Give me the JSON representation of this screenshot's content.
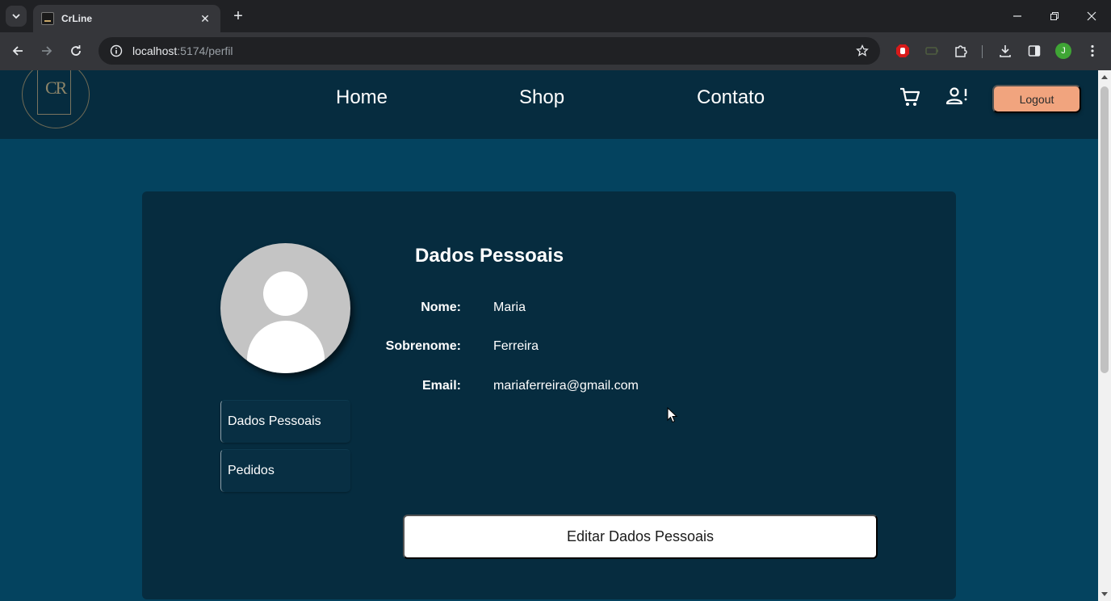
{
  "browser": {
    "tab_title": "CrLine",
    "close_glyph": "✕",
    "new_tab_glyph": "+",
    "url_host": "localhost",
    "url_path": ":5174/perfil",
    "profile_initial": "J"
  },
  "header": {
    "logo_text": "CR",
    "nav": {
      "home": "Home",
      "shop": "Shop",
      "contact": "Contato"
    },
    "logout_label": "Logout"
  },
  "profile": {
    "menu": {
      "personal": "Dados Pessoais",
      "orders": "Pedidos"
    },
    "section_title": "Dados Pessoais",
    "fields": {
      "name": {
        "label": "Nome:",
        "value": "Maria"
      },
      "surname": {
        "label": "Sobrenome:",
        "value": "Ferreira"
      },
      "email": {
        "label": "Email:",
        "value": "mariaferreira@gmail.com"
      }
    },
    "edit_label": "Editar Dados Pessoais"
  },
  "colors": {
    "page_bg": "#04435f",
    "header_bg": "#062c3f",
    "card_bg": "#062c3f",
    "logout_bg": "#f1a47e",
    "profile_badge": "#3fa535"
  }
}
